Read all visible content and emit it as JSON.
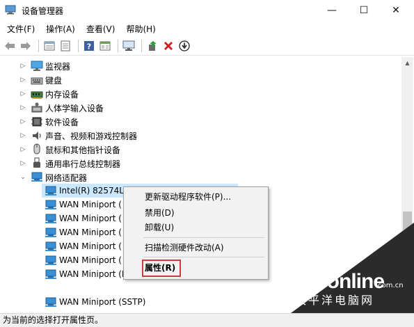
{
  "window": {
    "title": "设备管理器",
    "controls": {
      "minimize": "—",
      "maximize": "☐",
      "close": "✕"
    }
  },
  "menu": [
    "文件(F)",
    "操作(A)",
    "查看(V)",
    "帮助(H)"
  ],
  "toolbar": {
    "icons": [
      "back-arrow-icon",
      "forward-arrow-icon",
      "tree-view-icon",
      "properties-icon",
      "help-icon",
      "view-details-icon",
      "monitor-scan-icon",
      "update-driver-icon",
      "uninstall-x-icon",
      "download-icon"
    ]
  },
  "tree": {
    "categories": [
      {
        "label": "监视器",
        "icon": "monitor-icon"
      },
      {
        "label": "键盘",
        "icon": "keyboard-icon"
      },
      {
        "label": "内存设备",
        "icon": "memory-icon"
      },
      {
        "label": "人体学输入设备",
        "icon": "hid-icon"
      },
      {
        "label": "软件设备",
        "icon": "software-device-icon"
      },
      {
        "label": "声音、视频和游戏控制器",
        "icon": "speaker-icon"
      },
      {
        "label": "鼠标和其他指针设备",
        "icon": "mouse-icon"
      },
      {
        "label": "通用串行总线控制器",
        "icon": "usb-icon"
      }
    ],
    "network": {
      "label": "网络适配器",
      "icon": "network-adapter-icon",
      "children": [
        "Intel(R) 82574L",
        "WAN Miniport (",
        "WAN Miniport (",
        "WAN Miniport (",
        "WAN Miniport (",
        "WAN Miniport (",
        "WAN Miniport (PPTP)",
        "WAN Miniport (SSTP)"
      ]
    }
  },
  "context_menu": {
    "items": [
      "更新驱动程序软件(P)...",
      "禁用(D)",
      "卸载(U)",
      "扫描检测硬件改动(A)",
      "属性(R)"
    ]
  },
  "statusbar": {
    "text": "为当前的选择打开属性页。"
  },
  "watermark": {
    "brand": "PConline",
    "domain": ".com.cn",
    "brand_cn": "太平洋电脑网"
  },
  "colors": {
    "highlight": "#cce8ff",
    "accent_red": "#d23b3b",
    "net_icon": "#3a8fd6"
  }
}
